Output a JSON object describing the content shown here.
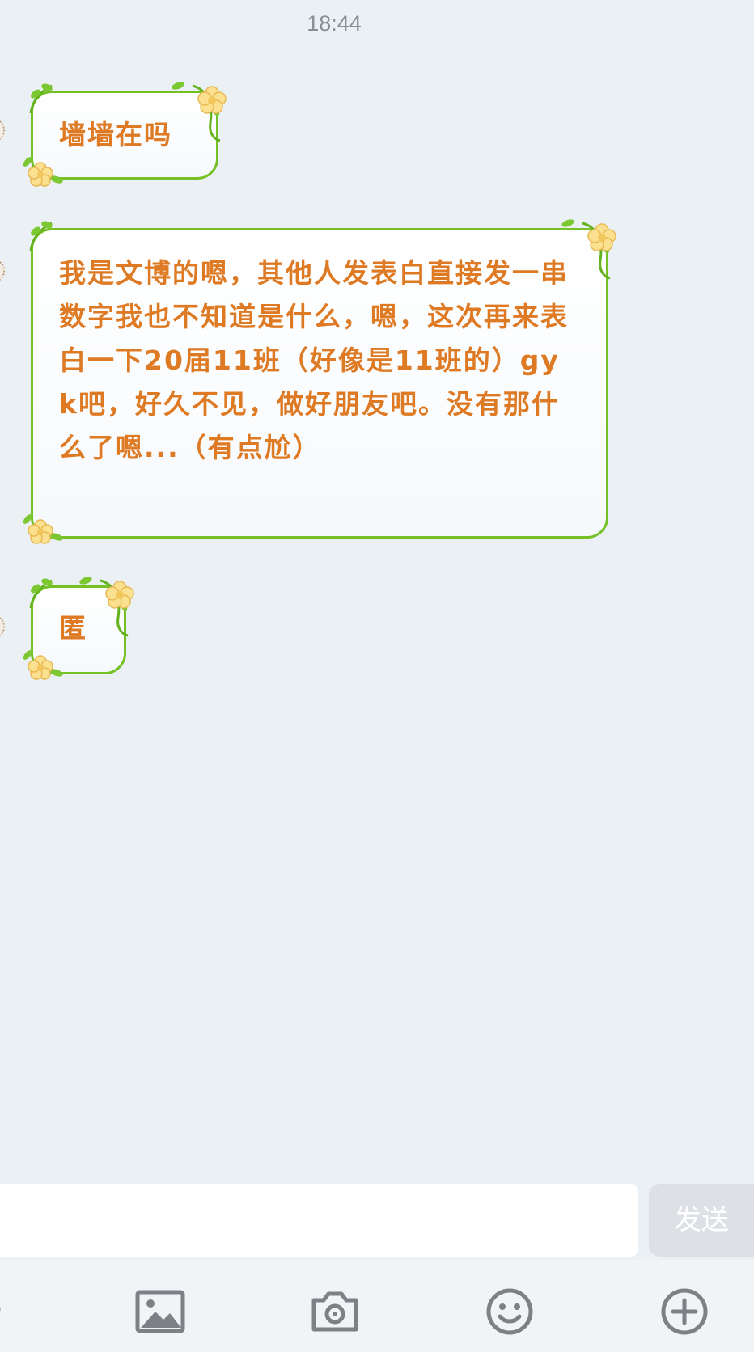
{
  "chat": {
    "timestamp": "18:44",
    "messages": [
      {
        "text": "墙墙在吗"
      },
      {
        "text": "我是文博的嗯，其他人发表白直接发一串数字我也不知道是什么，嗯，这次再来表白一下20届11班（好像是11班的）gyk吧，好久不见，做好朋友吧。没有那什么了嗯...（有点尬）"
      },
      {
        "text": "匿"
      }
    ]
  },
  "composer": {
    "input_value": "",
    "send_label": "发送"
  },
  "toolbar": {
    "icons": [
      "voice-icon",
      "image-icon",
      "camera-icon",
      "emoji-icon",
      "plus-icon"
    ]
  },
  "theme": {
    "background": "#ebf0f5",
    "bubble_border": "#74c025",
    "bubble_text": "#de7a24",
    "flower": "#fbe08f",
    "send_button_bg": "#dde1e5",
    "icon_color": "#7d8185"
  }
}
